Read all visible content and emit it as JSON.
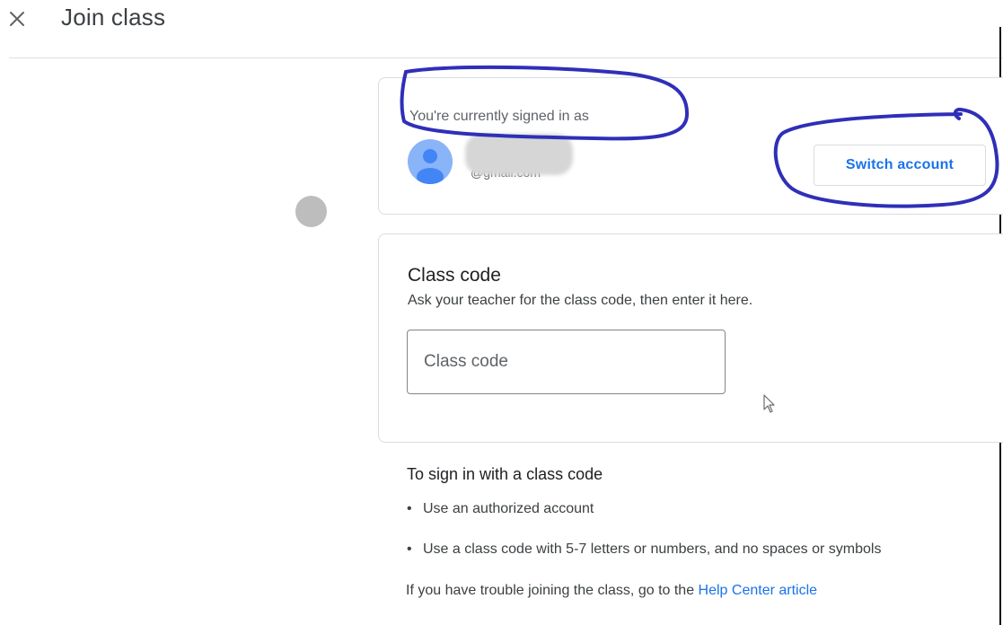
{
  "header": {
    "close_icon": "close-icon",
    "title": "Join class"
  },
  "account": {
    "signed_in_label": "You're currently signed in as",
    "name_visible": "a",
    "email_visible": "@gmail.com",
    "avatar_icon": "person-icon",
    "switch_button_label": "Switch account"
  },
  "class_code": {
    "title": "Class code",
    "description": "Ask your teacher for the class code, then enter it here.",
    "input_placeholder": "Class code",
    "input_value": ""
  },
  "info": {
    "title": "To sign in with a class code",
    "bullets": [
      "Use an authorized account",
      "Use a class code with 5-7 letters or numbers, and no spaces or symbols"
    ],
    "help_text": "If you have trouble joining the class, go to the ",
    "help_link": "Help Center article"
  },
  "colors": {
    "link_blue": "#1a73e8",
    "avatar_bg": "#8ab4f8",
    "avatar_fg": "#4285f4",
    "annotation_ink": "#2f2fb8"
  }
}
